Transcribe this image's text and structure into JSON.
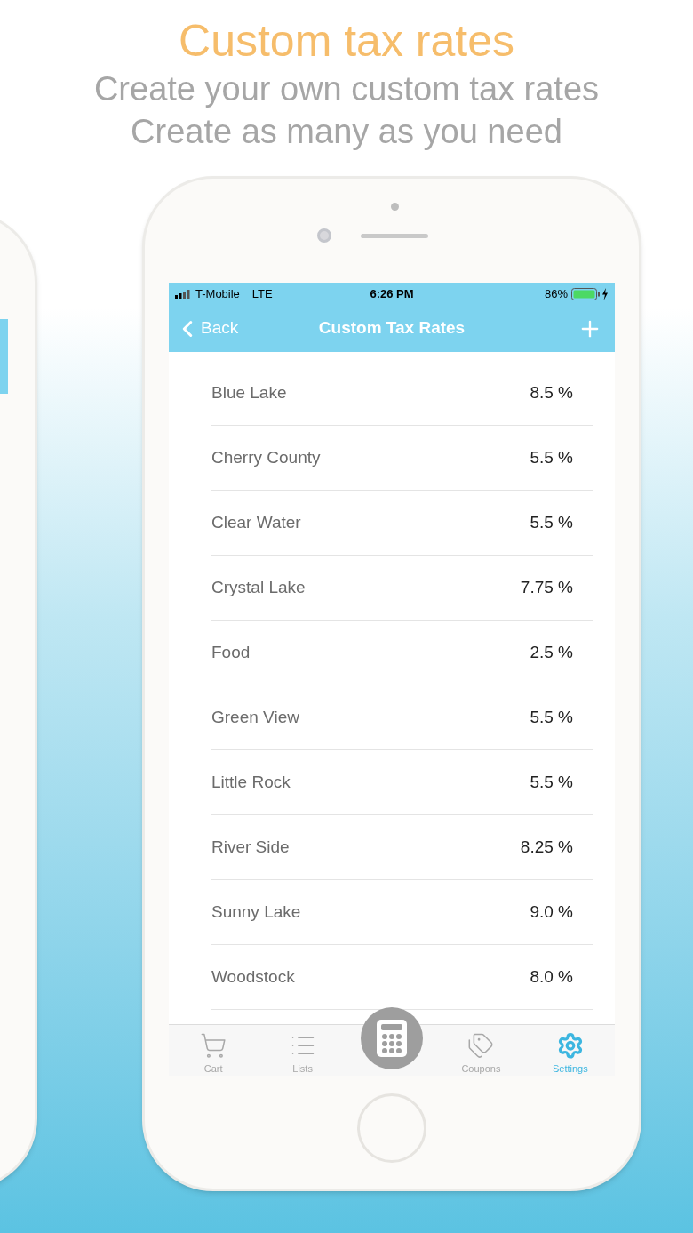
{
  "headline": {
    "title": "Custom tax rates",
    "lines": [
      "Create your own custom tax rates",
      "Create as many as you need"
    ]
  },
  "status_bar": {
    "carrier": "T-Mobile",
    "network": "LTE",
    "time": "6:26 PM",
    "battery": "86%"
  },
  "nav_bar": {
    "back": "Back",
    "title": "Custom Tax Rates"
  },
  "rates": [
    {
      "name": "Blue Lake",
      "rate": "8.5 %"
    },
    {
      "name": "Cherry County",
      "rate": "5.5 %"
    },
    {
      "name": "Clear Water",
      "rate": "5.5 %"
    },
    {
      "name": "Crystal Lake",
      "rate": "7.75 %"
    },
    {
      "name": "Food",
      "rate": "2.5 %"
    },
    {
      "name": "Green View",
      "rate": "5.5 %"
    },
    {
      "name": "Little Rock",
      "rate": "5.5 %"
    },
    {
      "name": "River Side",
      "rate": "8.25 %"
    },
    {
      "name": "Sunny Lake",
      "rate": "9.0 %"
    },
    {
      "name": "Woodstock",
      "rate": "8.0 %"
    }
  ],
  "tab_bar": [
    {
      "kind": "cart",
      "label": "Cart",
      "selected": false
    },
    {
      "kind": "list",
      "label": "Lists",
      "selected": false
    },
    {
      "kind": "calculator",
      "selected": false
    },
    {
      "kind": "tag",
      "label": "Coupons",
      "selected": false
    },
    {
      "kind": "gear",
      "label": "Settings",
      "selected": true
    }
  ]
}
